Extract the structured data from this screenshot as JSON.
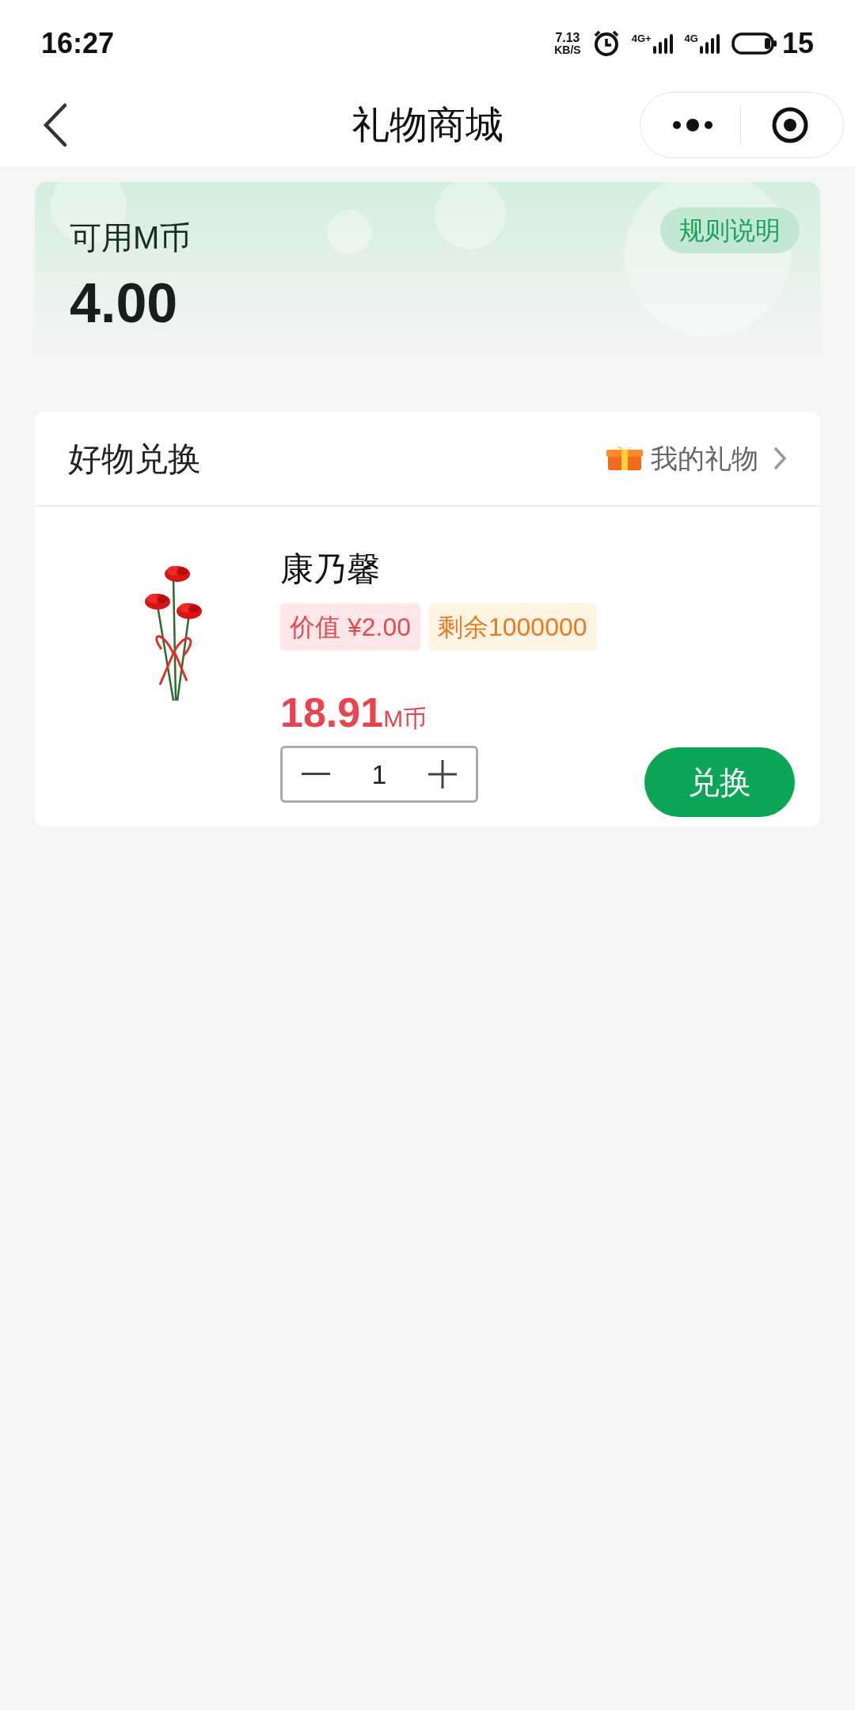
{
  "status_bar": {
    "time": "16:27",
    "speed_value": "7.13",
    "speed_unit": "KB/S",
    "network_1": "4G+",
    "network_2": "4G",
    "battery": "15"
  },
  "nav": {
    "title": "礼物商城"
  },
  "balance": {
    "label": "可用M币",
    "value": "4.00",
    "rules_button": "规则说明"
  },
  "section": {
    "title": "好物兑换",
    "link": "我的礼物"
  },
  "products": [
    {
      "name": "康乃馨",
      "value_tag": "价值 ¥2.00",
      "stock_tag": "剩余1000000",
      "price": "18.91",
      "price_unit": "M币",
      "quantity": "1",
      "button": "兑换"
    }
  ]
}
